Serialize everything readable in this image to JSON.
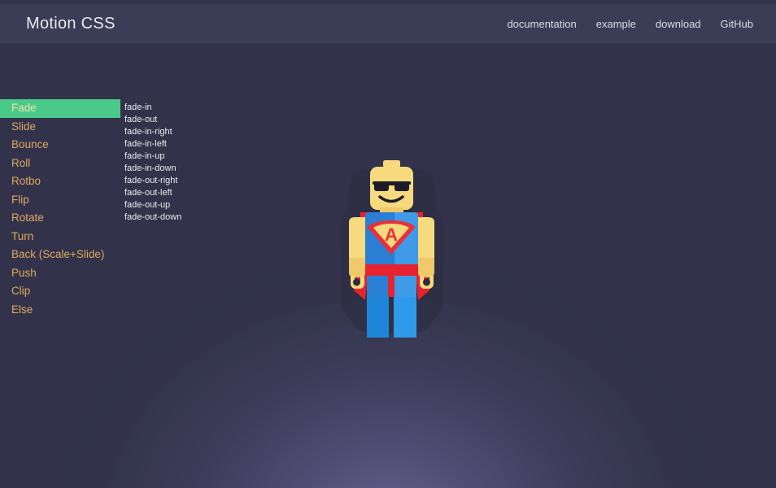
{
  "header": {
    "brand": "Motion CSS",
    "nav": [
      {
        "label": "documentation",
        "name": "nav-documentation"
      },
      {
        "label": "example",
        "name": "nav-example"
      },
      {
        "label": "download",
        "name": "nav-download"
      },
      {
        "label": "GitHub",
        "name": "nav-github"
      }
    ]
  },
  "sidebar": {
    "active_index": 0,
    "items": [
      {
        "label": "Fade"
      },
      {
        "label": "Slide"
      },
      {
        "label": "Bounce"
      },
      {
        "label": "Roll"
      },
      {
        "label": "Rotbo"
      },
      {
        "label": "Flip"
      },
      {
        "label": "Rotate"
      },
      {
        "label": "Turn"
      },
      {
        "label": "Back (Scale+Slide)"
      },
      {
        "label": "Push"
      },
      {
        "label": "Clip"
      },
      {
        "label": "Else"
      }
    ]
  },
  "animations": {
    "items": [
      {
        "label": "fade-in"
      },
      {
        "label": "fade-out"
      },
      {
        "label": "fade-in-right"
      },
      {
        "label": "fade-in-left"
      },
      {
        "label": "fade-in-up"
      },
      {
        "label": "fade-in-down"
      },
      {
        "label": "fade-out-right"
      },
      {
        "label": "fade-out-left"
      },
      {
        "label": "fade-out-up"
      },
      {
        "label": "fade-out-down"
      }
    ]
  },
  "figure": {
    "name": "lego-superhero-minifigure",
    "emblem_letter": "A",
    "colors": {
      "skin": "#f7d97e",
      "skin_shadow": "#efc96a",
      "cape": "#e8222e",
      "torso_blue": "#2a7fd4",
      "torso_blue_light": "#3f9ae8",
      "legs_blue": "#1e86d8",
      "legs_blue_light": "#2e9ae9",
      "belt_red": "#e8222e",
      "emblem_yellow": "#f7d97e",
      "emblem_red": "#e8303a",
      "sunglasses": "#1b1b28",
      "shadow": "#2b2c40"
    }
  },
  "theme": {
    "page_background": "#32334a",
    "header_background": "#3b3c56",
    "accent_green": "#4ac98a",
    "sidebar_text": "#e0a95f",
    "active_text": "#f2e2a8",
    "list_text": "#eceaf2",
    "glow_purple": "#877db9"
  }
}
